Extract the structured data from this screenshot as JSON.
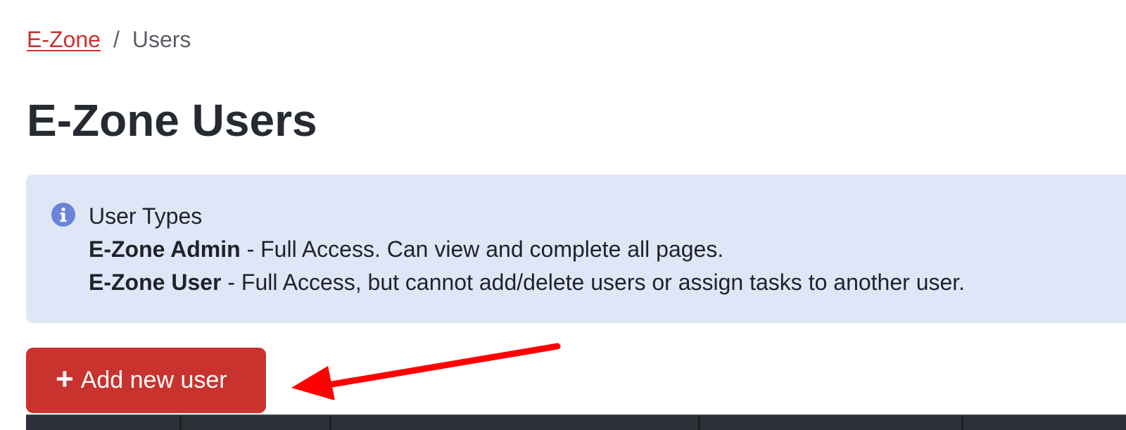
{
  "breadcrumb": {
    "root": "E-Zone",
    "separator": "/",
    "current": "Users"
  },
  "page": {
    "title": "E-Zone Users"
  },
  "info": {
    "icon": "info-circle-icon",
    "heading": "User Types",
    "admin_label": "E-Zone Admin",
    "admin_desc": " - Full Access. Can view and complete all pages.",
    "user_label": "E-Zone User",
    "user_desc": " - Full Access, but cannot add/delete users or assign tasks to another user."
  },
  "actions": {
    "add_icon": "+",
    "add_label": "Add new user"
  },
  "colors": {
    "brand_red": "#c9332e",
    "info_bg": "#dfe6f7",
    "info_icon": "#6a84d9",
    "table_header": "#2b2f36",
    "annotation_arrow": "#ff0000"
  }
}
